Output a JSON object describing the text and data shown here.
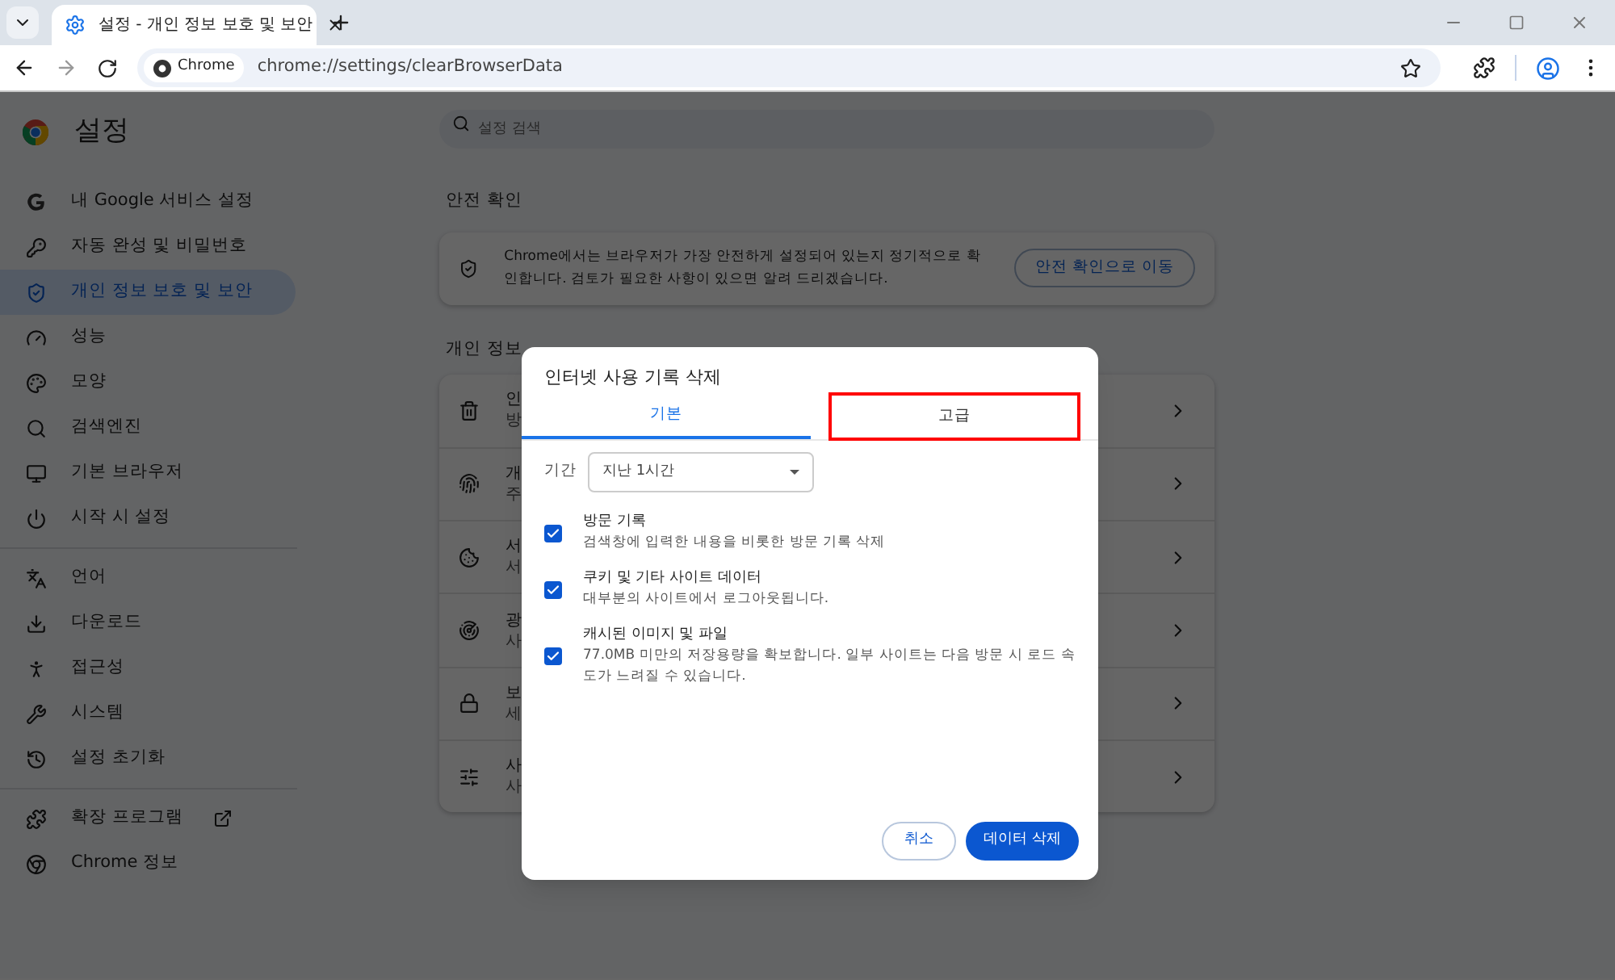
{
  "browser": {
    "tab_title": "설정 - 개인 정보 보호 및 보안",
    "site_chip": "Chrome",
    "url": "chrome://settings/clearBrowserData"
  },
  "sidebar": {
    "title": "설정",
    "groups": [
      [
        {
          "label": "내 Google 서비스 설정",
          "selected": false
        },
        {
          "label": "자동 완성 및 비밀번호",
          "selected": false
        },
        {
          "label": "개인 정보 보호 및 보안",
          "selected": true
        },
        {
          "label": "성능",
          "selected": false
        },
        {
          "label": "모양",
          "selected": false
        },
        {
          "label": "검색엔진",
          "selected": false
        },
        {
          "label": "기본 브라우저",
          "selected": false
        },
        {
          "label": "시작 시 설정",
          "selected": false
        }
      ],
      [
        {
          "label": "언어",
          "selected": false
        },
        {
          "label": "다운로드",
          "selected": false
        },
        {
          "label": "접근성",
          "selected": false
        },
        {
          "label": "시스템",
          "selected": false
        },
        {
          "label": "설정 초기화",
          "selected": false
        }
      ],
      [
        {
          "label": "확장 프로그램",
          "selected": false,
          "external": true
        },
        {
          "label": "Chrome 정보",
          "selected": false,
          "external": false
        }
      ]
    ]
  },
  "search": {
    "placeholder": "설정 검색"
  },
  "safety_check": {
    "heading": "안전 확인",
    "text": "Chrome에서는 브라우저가 가장 안전하게 설정되어 있는지 정기적으로 확인합니다. 검토가 필요한 사항이 있으면 알려 드리겠습니다.",
    "button": "안전 확인으로 이동"
  },
  "privacy": {
    "heading": "개인 정보",
    "rows": [
      {
        "title": "인",
        "subtitle": "방"
      },
      {
        "title": "개",
        "subtitle": "주"
      },
      {
        "title": "서",
        "subtitle": "서"
      },
      {
        "title": "광",
        "subtitle": "사"
      },
      {
        "title": "보",
        "subtitle": "세"
      },
      {
        "title": "사",
        "subtitle": "사"
      }
    ]
  },
  "dialog": {
    "title": "인터넷 사용 기록 삭제",
    "tabs": [
      {
        "label": "기본",
        "selected": true,
        "highlighted": false
      },
      {
        "label": "고급",
        "selected": false,
        "highlighted": true
      }
    ],
    "period_label": "기간",
    "period_value": "지난 1시간",
    "options": [
      {
        "title": "방문 기록",
        "description": "검색창에 입력한 내용을 비롯한 방문 기록 삭제",
        "checked": true
      },
      {
        "title": "쿠키 및 기타 사이트 데이터",
        "description": "대부분의 사이트에서 로그아웃됩니다.",
        "checked": true
      },
      {
        "title": "캐시된 이미지 및 파일",
        "description": "77.0MB 미만의 저장용량을 확보합니다. 일부 사이트는 다음 방문 시 로드 속도가 느려질 수 있습니다.",
        "checked": true
      }
    ],
    "cancel": "취소",
    "confirm": "데이터 삭제"
  }
}
